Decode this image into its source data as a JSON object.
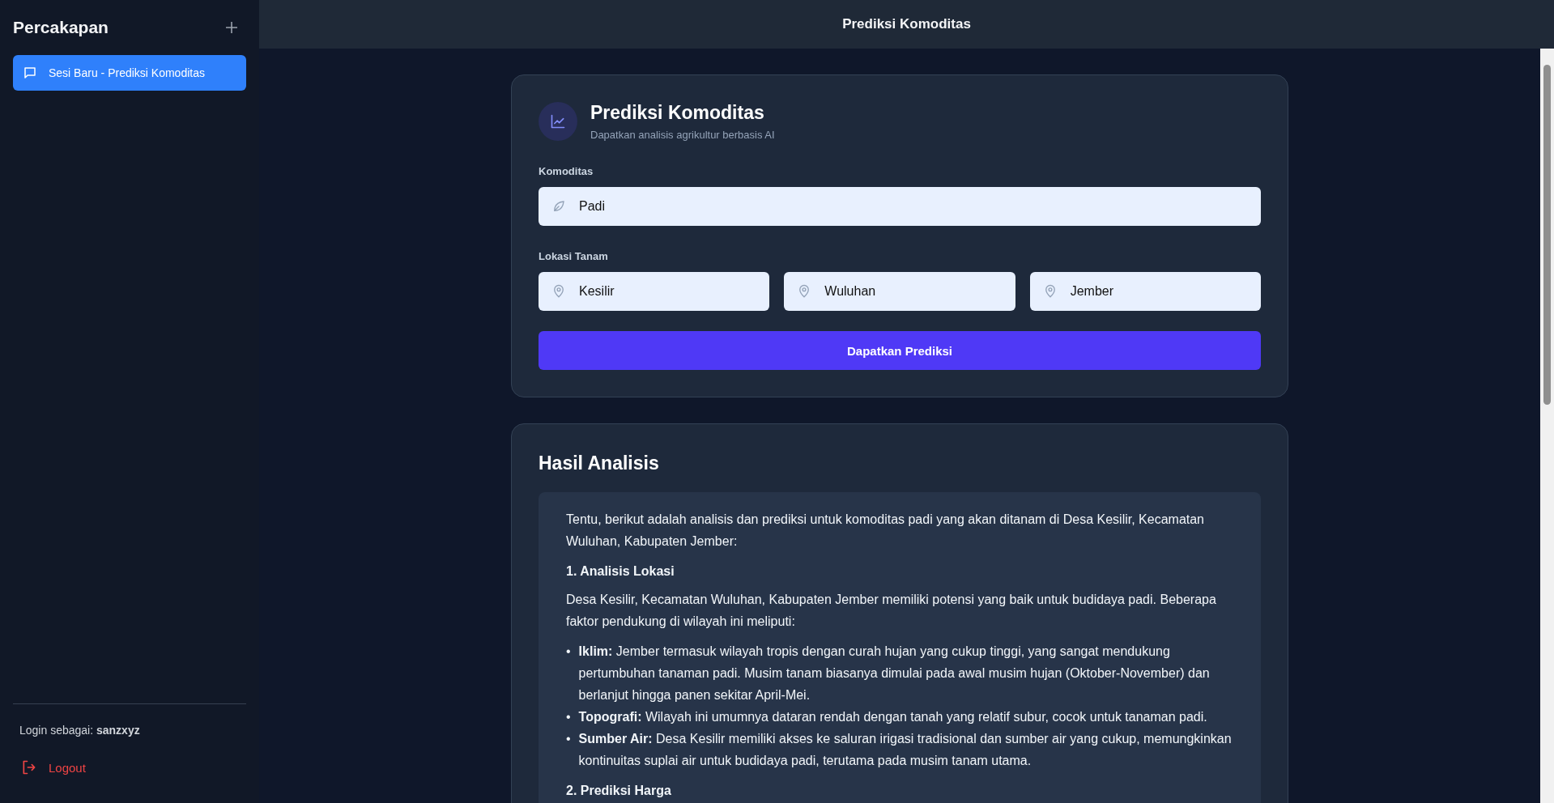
{
  "sidebar": {
    "title": "Percakapan",
    "sessions": [
      {
        "label": "Sesi Baru - Prediksi Komoditas",
        "selected": true
      }
    ],
    "login": "Login sebagai: **sanzxyz**",
    "logout": "Logout"
  },
  "header": {
    "title": "Prediksi Komoditas"
  },
  "form": {
    "title": "Prediksi Komoditas",
    "subtitle": "Dapatkan analisis agrikultur berbasis AI",
    "commodity_label": "Komoditas",
    "commodity_value": "Padi",
    "location_label": "Lokasi Tanam",
    "locations": [
      {
        "value": "Kesilir"
      },
      {
        "value": "Wuluhan"
      },
      {
        "value": "Jember"
      }
    ],
    "submit": "Dapatkan Prediksi"
  },
  "results": {
    "title": "Hasil Analisis",
    "blocks": [
      {
        "kind": "paragraph",
        "text": "Tentu, berikut adalah analisis dan prediksi untuk komoditas padi yang akan ditanam di Desa Kesilir, Kecamatan Wuluhan, Kabupaten Jember:"
      },
      {
        "kind": "heading",
        "text": "1. Analisis Lokasi"
      },
      {
        "kind": "paragraph",
        "text": "Desa Kesilir, Kecamatan Wuluhan, Kabupaten Jember memiliki potensi yang baik untuk budidaya padi. Beberapa faktor pendukung di wilayah ini meliputi:"
      },
      {
        "kind": "list",
        "items": [
          {
            "bullet": "•",
            "text": "**Iklim:** Jember termasuk wilayah tropis dengan curah hujan yang cukup tinggi, yang sangat mendukung pertumbuhan tanaman padi. Musim tanam biasanya dimulai pada awal musim hujan (Oktober-November) dan berlanjut hingga panen sekitar April-Mei."
          },
          {
            "bullet": "•",
            "text": "**Topografi:** Wilayah ini umumnya dataran rendah dengan tanah yang relatif subur, cocok untuk tanaman padi."
          },
          {
            "bullet": "•",
            "text": "**Sumber Air:** Desa Kesilir memiliki akses ke saluran irigasi tradisional dan sumber air yang cukup, memungkinkan kontinuitas suplai air untuk budidaya padi, terutama pada musim tanam utama."
          }
        ]
      },
      {
        "kind": "heading",
        "text": "2. Prediksi Harga"
      }
    ]
  }
}
